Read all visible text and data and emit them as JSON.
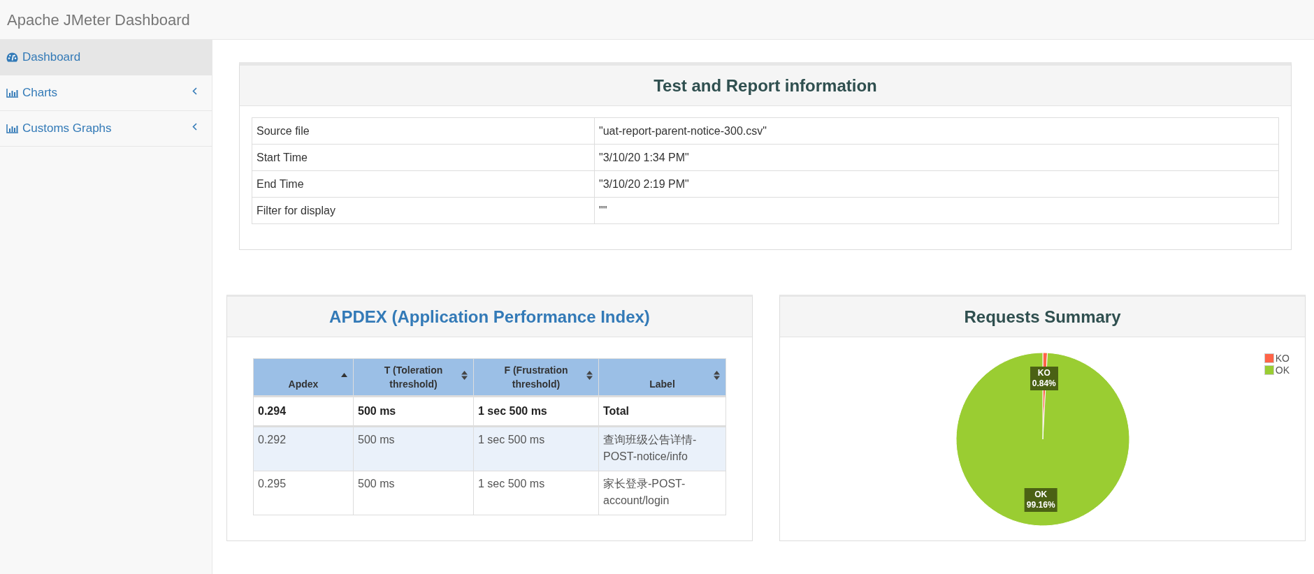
{
  "header": {
    "title": "Apache JMeter Dashboard"
  },
  "sidebar": {
    "items": [
      {
        "label": "Dashboard",
        "selected": true,
        "has_submenu": false
      },
      {
        "label": "Charts",
        "selected": false,
        "has_submenu": true
      },
      {
        "label": "Customs Graphs",
        "selected": false,
        "has_submenu": true
      }
    ]
  },
  "info_panel": {
    "title": "Test and Report information",
    "rows": [
      {
        "name": "Source file",
        "value": "\"uat-report-parent-notice-300.csv\""
      },
      {
        "name": "Start Time",
        "value": "\"3/10/20 1:34 PM\""
      },
      {
        "name": "End Time",
        "value": "\"3/10/20 2:19 PM\""
      },
      {
        "name": "Filter for display",
        "value": "\"\""
      }
    ]
  },
  "apdex_panel": {
    "title": "APDEX (Application Performance Index)",
    "columns": [
      {
        "label": "Apdex",
        "sorted": true
      },
      {
        "label": "T (Toleration threshold)",
        "sorted": false
      },
      {
        "label": "F (Frustration threshold)",
        "sorted": false
      },
      {
        "label": "Label",
        "sorted": false
      }
    ],
    "rows": [
      {
        "kind": "total",
        "highlighted": false,
        "cells": [
          "0.294",
          "500 ms",
          "1 sec 500 ms",
          "Total"
        ]
      },
      {
        "kind": "item",
        "highlighted": true,
        "cells": [
          "0.292",
          "500 ms",
          "1 sec 500 ms",
          "查询班级公告详情-POST-notice/info"
        ]
      },
      {
        "kind": "item",
        "highlighted": false,
        "cells": [
          "0.295",
          "500 ms",
          "1 sec 500 ms",
          "家长登录-POST-account/login"
        ]
      }
    ]
  },
  "requests_panel": {
    "title": "Requests Summary",
    "legend": [
      {
        "label": "KO",
        "color": "#ff6347"
      },
      {
        "label": "OK",
        "color": "#9acd32"
      }
    ],
    "chart_data": {
      "type": "pie",
      "categories": [
        "KO",
        "OK"
      ],
      "values": [
        0.84,
        99.16
      ],
      "data_labels": true,
      "value_labels": [
        "0.84%",
        "99.16%"
      ]
    }
  }
}
